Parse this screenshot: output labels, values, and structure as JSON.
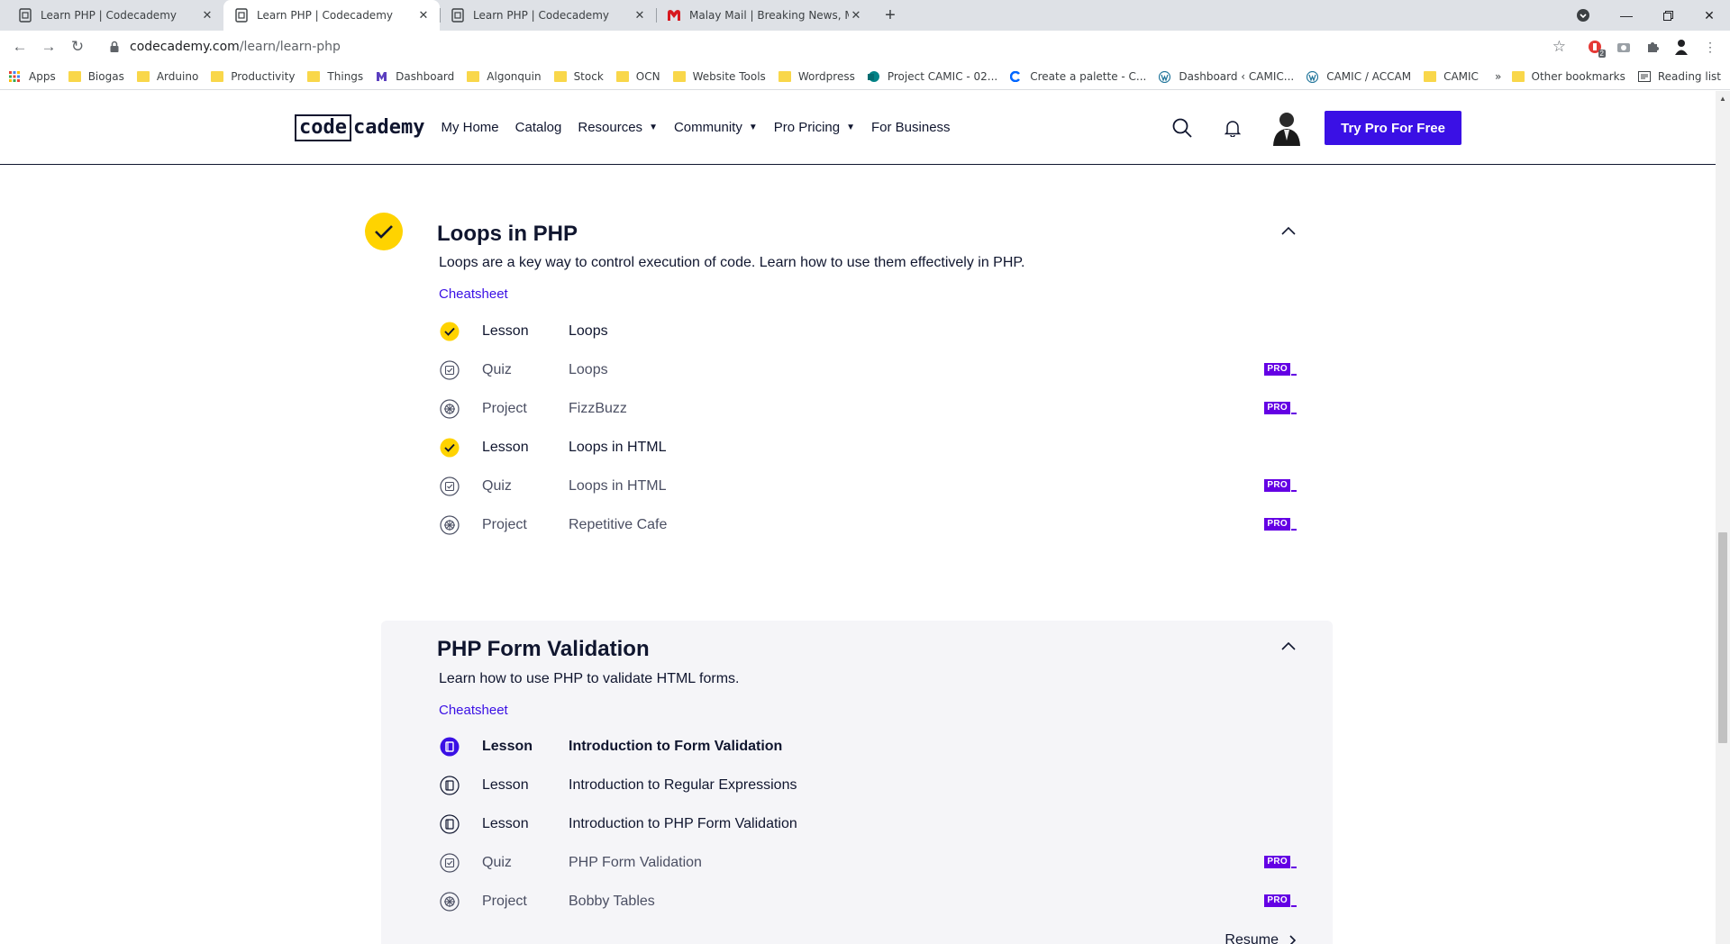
{
  "browser": {
    "tabs": [
      {
        "title": "Learn PHP | Codecademy",
        "active": false,
        "favicon": "codecademy-icon"
      },
      {
        "title": "Learn PHP | Codecademy",
        "active": true,
        "favicon": "codecademy-icon"
      },
      {
        "title": "Learn PHP | Codecademy",
        "active": false,
        "favicon": "codecademy-icon"
      },
      {
        "title": "Malay Mail | Breaking News, Mala",
        "active": false,
        "favicon": "malaymail-icon"
      }
    ],
    "url_domain": "codecademy.com",
    "url_path": "/learn/learn-php",
    "bookmarks": [
      {
        "label": "Apps",
        "icon": "apps-grid-icon"
      },
      {
        "label": "Biogas",
        "icon": "folder-icon"
      },
      {
        "label": "Arduino",
        "icon": "folder-icon"
      },
      {
        "label": "Productivity",
        "icon": "folder-icon"
      },
      {
        "label": "Things",
        "icon": "folder-icon"
      },
      {
        "label": "Dashboard",
        "icon": "dashboard-icon"
      },
      {
        "label": "Algonquin",
        "icon": "folder-icon"
      },
      {
        "label": "Stock",
        "icon": "folder-icon"
      },
      {
        "label": "OCN",
        "icon": "folder-icon"
      },
      {
        "label": "Website Tools",
        "icon": "folder-icon"
      },
      {
        "label": "Wordpress",
        "icon": "folder-icon"
      },
      {
        "label": "Project CAMIC - 02...",
        "icon": "sharepoint-icon"
      },
      {
        "label": "Create a palette - C...",
        "icon": "coolors-icon"
      },
      {
        "label": "Dashboard ‹ CAMIC...",
        "icon": "wordpress-icon"
      },
      {
        "label": "CAMIC / ACCAM",
        "icon": "wordpress-icon"
      },
      {
        "label": "CAMIC",
        "icon": "folder-icon"
      }
    ],
    "bookmarks_more": "»",
    "other_bookmarks": "Other bookmarks",
    "reading_list": "Reading list",
    "ext_badge": "2"
  },
  "header": {
    "logo_box": "code",
    "logo_rest": "cademy",
    "nav": [
      {
        "label": "My Home",
        "caret": false
      },
      {
        "label": "Catalog",
        "caret": false
      },
      {
        "label": "Resources",
        "caret": true
      },
      {
        "label": "Community",
        "caret": true
      },
      {
        "label": "Pro Pricing",
        "caret": true
      },
      {
        "label": "For Business",
        "caret": false
      }
    ],
    "cta": "Try Pro For Free"
  },
  "modules": [
    {
      "title": "Loops in PHP",
      "description": "Loops are a key way to control execution of code. Learn how to use them effectively in PHP.",
      "cheatsheet": "Cheatsheet",
      "completed": true,
      "items": [
        {
          "kind": "Lesson",
          "name": "Loops",
          "state": "done",
          "pro": false
        },
        {
          "kind": "Quiz",
          "name": "Loops",
          "state": "locked",
          "pro": true
        },
        {
          "kind": "Project",
          "name": "FizzBuzz",
          "state": "locked",
          "pro": true
        },
        {
          "kind": "Lesson",
          "name": "Loops in HTML",
          "state": "done",
          "pro": false
        },
        {
          "kind": "Quiz",
          "name": "Loops in HTML",
          "state": "locked",
          "pro": true
        },
        {
          "kind": "Project",
          "name": "Repetitive Cafe",
          "state": "locked",
          "pro": true
        }
      ]
    },
    {
      "title": "PHP Form Validation",
      "description": "Learn how to use PHP to validate HTML forms.",
      "cheatsheet": "Cheatsheet",
      "completed": false,
      "items": [
        {
          "kind": "Lesson",
          "name": "Introduction to Form Validation",
          "state": "current",
          "pro": false
        },
        {
          "kind": "Lesson",
          "name": "Introduction to Regular Expressions",
          "state": "plain",
          "pro": false
        },
        {
          "kind": "Lesson",
          "name": "Introduction to PHP Form Validation",
          "state": "plain",
          "pro": false
        },
        {
          "kind": "Quiz",
          "name": "PHP Form Validation",
          "state": "locked",
          "pro": true
        },
        {
          "kind": "Project",
          "name": "Bobby Tables",
          "state": "locked",
          "pro": true
        }
      ],
      "resume": "Resume"
    }
  ],
  "pro_label": "PRO",
  "colors": {
    "accent": "#3a10e5",
    "check": "#ffd300",
    "pro": "#6400e4",
    "text": "#10162f"
  }
}
